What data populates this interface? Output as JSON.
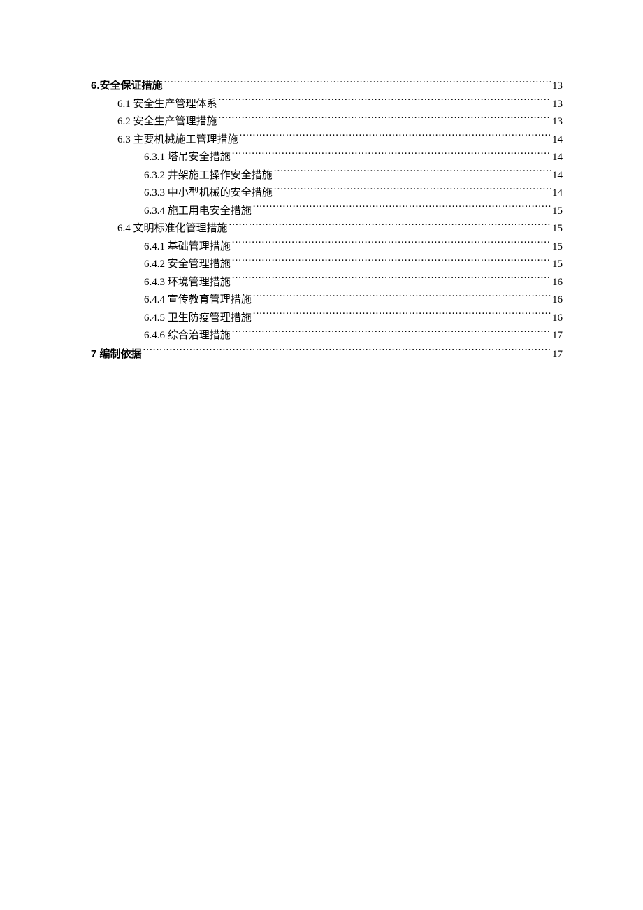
{
  "toc": {
    "entries": [
      {
        "title": "6.安全保证措施",
        "page": "13",
        "level": 0,
        "bold": true
      },
      {
        "title": "6.1 安全生产管理体系",
        "page": "13",
        "level": 1,
        "bold": false
      },
      {
        "title": "6.2 安全生产管理措施",
        "page": "13",
        "level": 1,
        "bold": false
      },
      {
        "title": "6.3 主要机械施工管理措施",
        "page": "14",
        "level": 1,
        "bold": false
      },
      {
        "title": "6.3.1 塔吊安全措施",
        "page": "14",
        "level": 2,
        "bold": false
      },
      {
        "title": "6.3.2 井架施工操作安全措施",
        "page": "14",
        "level": 2,
        "bold": false
      },
      {
        "title": "6.3.3 中小型机械的安全措施",
        "page": "14",
        "level": 2,
        "bold": false
      },
      {
        "title": "6.3.4 施工用电安全措施",
        "page": "15",
        "level": 2,
        "bold": false
      },
      {
        "title": "6.4 文明标准化管理措施",
        "page": "15",
        "level": 1,
        "bold": false
      },
      {
        "title": "6.4.1 基础管理措施",
        "page": "15",
        "level": 2,
        "bold": false
      },
      {
        "title": "6.4.2 安全管理措施",
        "page": "15",
        "level": 2,
        "bold": false
      },
      {
        "title": "6.4.3 环境管理措施",
        "page": "16",
        "level": 2,
        "bold": false
      },
      {
        "title": "6.4.4 宣传教育管理措施",
        "page": "16",
        "level": 2,
        "bold": false
      },
      {
        "title": "6.4.5 卫生防疫管理措施",
        "page": "16",
        "level": 2,
        "bold": false
      },
      {
        "title": "6.4.6 综合治理措施",
        "page": "17",
        "level": 2,
        "bold": false
      },
      {
        "title": "7 编制依据",
        "page": "17",
        "level": 0,
        "bold": true
      }
    ]
  }
}
